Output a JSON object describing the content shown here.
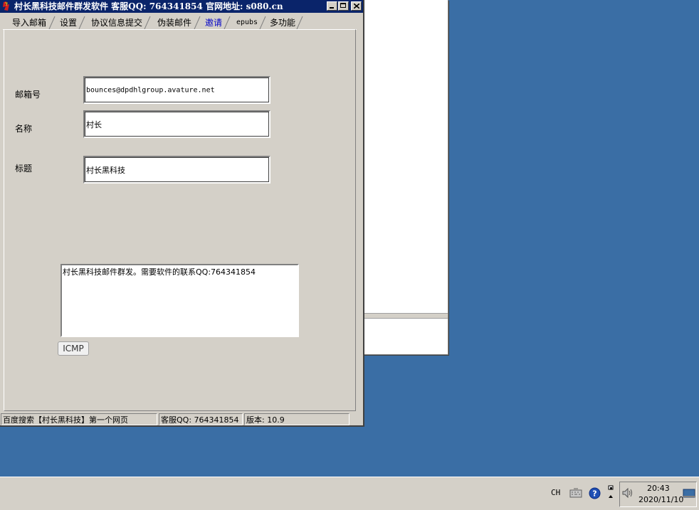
{
  "window": {
    "title": "村长黑科技邮件群发软件   客服QQ: 764341854   官网地址: s080.cn"
  },
  "tabs": [
    {
      "label": "导入邮箱"
    },
    {
      "label": "设置"
    },
    {
      "label": "协议信息提交"
    },
    {
      "label": "伪装邮件"
    },
    {
      "label": "邀请",
      "active": true
    },
    {
      "label": "epubs"
    },
    {
      "label": "多功能"
    }
  ],
  "form": {
    "email_label": "邮箱号",
    "email_value": "bounces@dpdhlgroup.avature.net",
    "name_label": "名称",
    "name_value": "村长",
    "subject_label": "标题",
    "subject_value": "村长黑科技",
    "body_value": "村长黑科技邮件群发。需要软件的联系QQ:764341854",
    "icmp_button": "ICMP"
  },
  "statusbar": {
    "search_text": "百度搜索【村长黑科技】第一个网页",
    "qq_text": "客服QQ: 764341854",
    "version_text": "版本: 10.9"
  },
  "taskbar": {
    "ime": "CH",
    "time": "20:43",
    "date": "2020/11/10"
  },
  "icons": {
    "app": "app-logo-icon",
    "minimize": "minimize-icon",
    "maximize": "maximize-icon",
    "close": "close-icon",
    "keyboard": "keyboard-icon",
    "help": "help-icon",
    "network": "network-icon",
    "volume": "volume-icon",
    "show_desktop": "show-desktop-icon"
  },
  "colors": {
    "titlebar": "#0a246a",
    "desktop": "#3a6ea5",
    "face": "#d4d0c8",
    "active_tab": "#0000c8"
  }
}
